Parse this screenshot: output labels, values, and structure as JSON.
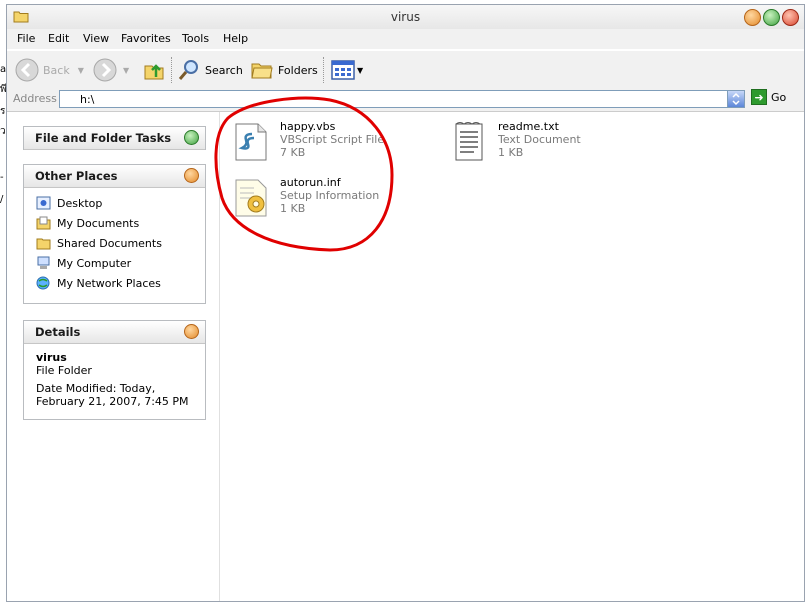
{
  "background_fragments": [
    "a",
    "พี",
    "รา",
    "ว",
    "-",
    "/"
  ],
  "window": {
    "title": "virus"
  },
  "menu": [
    "File",
    "Edit",
    "View",
    "Favorites",
    "Tools",
    "Help"
  ],
  "toolbar": {
    "back": "Back",
    "search": "Search",
    "folders": "Folders"
  },
  "address": {
    "label": "Address",
    "value": "h:\\",
    "go": "Go"
  },
  "sidebar": {
    "tasks_title": "File and Folder Tasks",
    "other_title": "Other Places",
    "places": [
      "Desktop",
      "My Documents",
      "Shared Documents",
      "My Computer",
      "My Network Places"
    ],
    "details_title": "Details",
    "details_name": "virus",
    "details_type": "File Folder",
    "details_modified": "Date Modified: Today, February 21, 2007, 7:45 PM"
  },
  "files": [
    {
      "name": "happy.vbs",
      "type": "VBScript Script File",
      "size": "7 KB",
      "icon": "script-icon"
    },
    {
      "name": "readme.txt",
      "type": "Text Document",
      "size": "1 KB",
      "icon": "text-document-icon"
    },
    {
      "name": "autorun.inf",
      "type": "Setup Information",
      "size": "1 KB",
      "icon": "setup-info-icon"
    }
  ],
  "colors": {
    "annotation": "#e00000",
    "close": "#d8452e",
    "minimize": "#e38b2b",
    "maximize": "#3fa23f"
  }
}
